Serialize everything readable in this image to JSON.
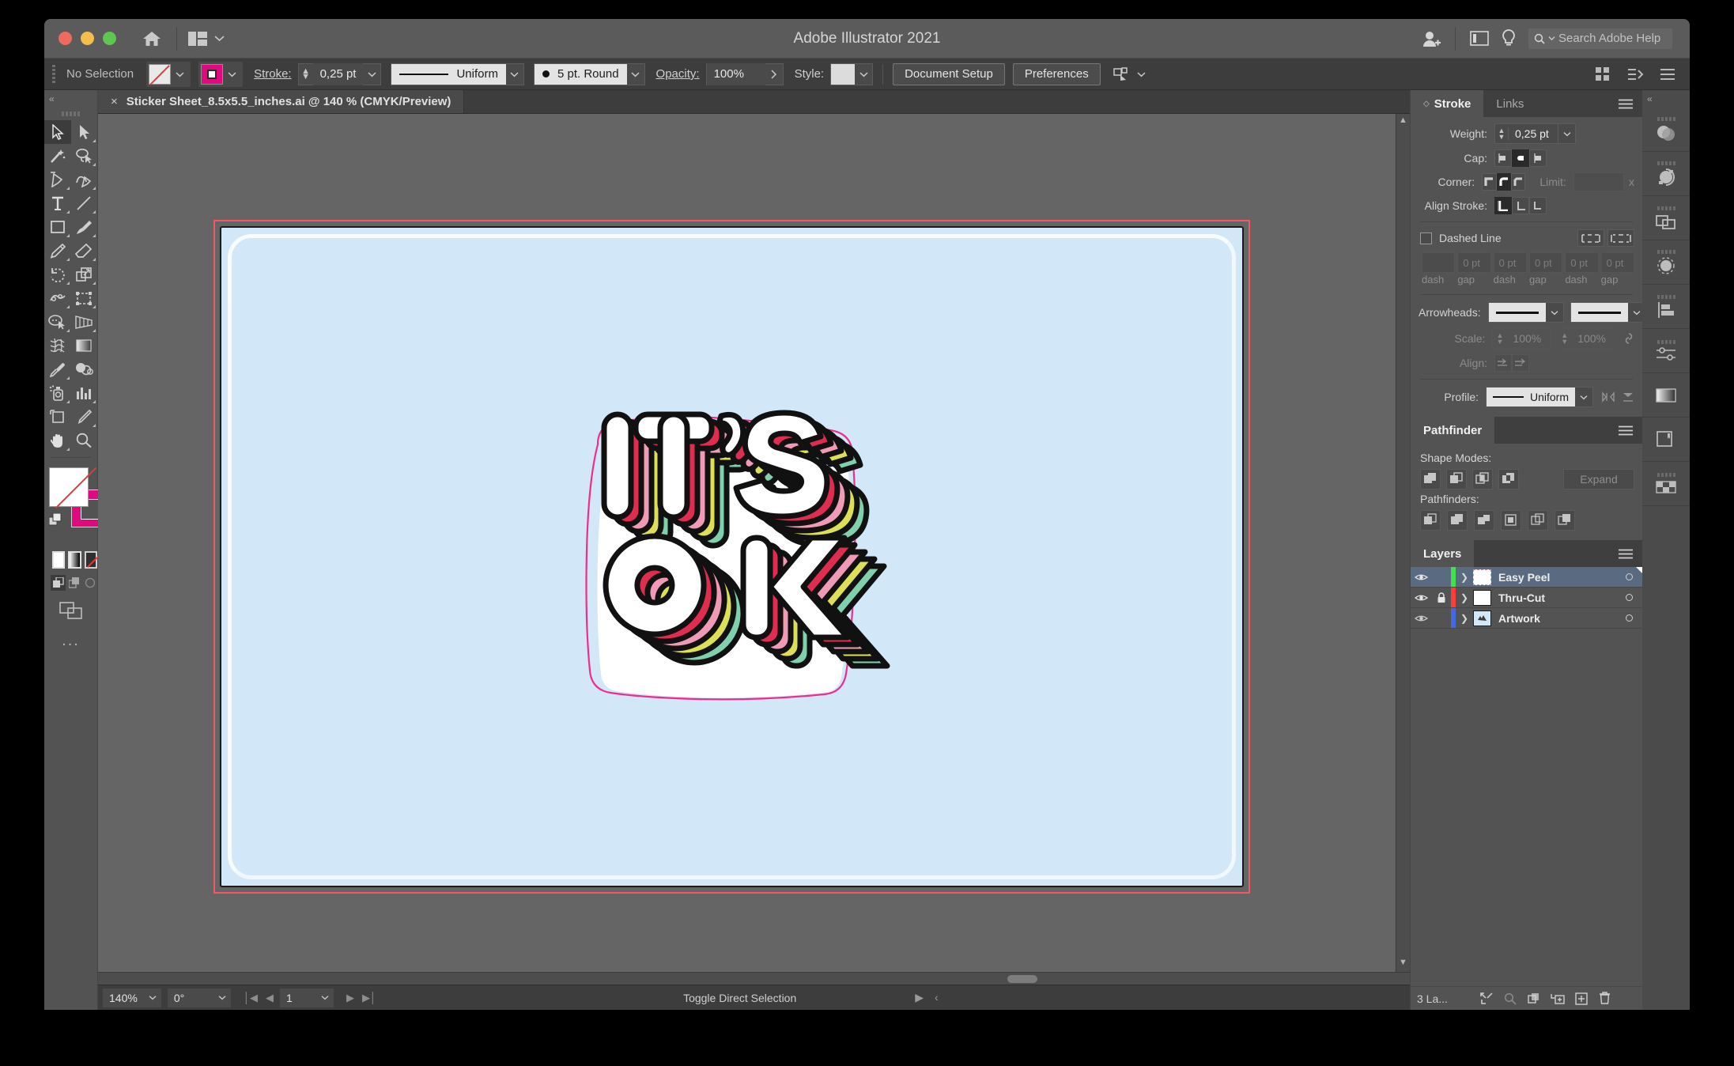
{
  "app": {
    "title": "Adobe Illustrator 2021"
  },
  "titlebar": {
    "home_icon": "home-icon",
    "arrange_icon": "arrange-documents-icon",
    "caret_icon": "chevron-down-icon",
    "account_icon": "account-add-icon",
    "panel_icon": "workspace-panel-icon",
    "tips_icon": "lightbulb-icon",
    "search_icon": "search-icon",
    "search_placeholder": "Search Adobe Help"
  },
  "controlbar": {
    "selection_status": "No Selection",
    "fill_swatch": "none",
    "stroke_swatch_color": "#e0097f",
    "stroke_label": "Stroke:",
    "stroke_weight": "0,25 pt",
    "variable_width_profile": "Uniform",
    "brush_definition": "5 pt. Round",
    "opacity_label": "Opacity:",
    "opacity_value": "100%",
    "style_label": "Style:",
    "document_setup_label": "Document Setup",
    "preferences_label": "Preferences",
    "align_icon": "align-objects-icon",
    "arrange_icon": "arrange-icon",
    "view_icon": "view-options-icon",
    "list_icon": "list-icon"
  },
  "tools": [
    {
      "name": "selection-tool",
      "icon": "arrow-solid",
      "selected": true
    },
    {
      "name": "direct-selection-tool",
      "icon": "arrow-hollow",
      "selected": false
    },
    {
      "name": "magic-wand-tool",
      "icon": "wand",
      "selected": false
    },
    {
      "name": "lasso-tool",
      "icon": "lasso",
      "selected": false
    },
    {
      "name": "pen-tool",
      "icon": "pen",
      "selected": false
    },
    {
      "name": "curvature-tool",
      "icon": "curvature",
      "selected": false
    },
    {
      "name": "type-tool",
      "icon": "type-t",
      "selected": false
    },
    {
      "name": "line-segment-tool",
      "icon": "line",
      "selected": false
    },
    {
      "name": "rectangle-tool",
      "icon": "rectangle",
      "selected": false
    },
    {
      "name": "paintbrush-tool",
      "icon": "brush",
      "selected": false
    },
    {
      "name": "pencil-tool",
      "icon": "pencil",
      "selected": false
    },
    {
      "name": "eraser-tool",
      "icon": "eraser",
      "selected": false
    },
    {
      "name": "rotate-tool",
      "icon": "rotate",
      "selected": false
    },
    {
      "name": "scale-tool",
      "icon": "scale",
      "selected": false
    },
    {
      "name": "width-tool",
      "icon": "width",
      "selected": false
    },
    {
      "name": "free-transform-tool",
      "icon": "free-transform",
      "selected": false
    },
    {
      "name": "shape-builder-tool",
      "icon": "shape-builder",
      "selected": false
    },
    {
      "name": "perspective-grid-tool",
      "icon": "perspective-grid",
      "selected": false
    },
    {
      "name": "mesh-tool",
      "icon": "mesh",
      "selected": false
    },
    {
      "name": "gradient-tool",
      "icon": "gradient",
      "selected": false
    },
    {
      "name": "eyedropper-tool",
      "icon": "eyedropper",
      "selected": false
    },
    {
      "name": "blend-tool",
      "icon": "blend",
      "selected": false
    },
    {
      "name": "symbol-sprayer-tool",
      "icon": "symbol-sprayer",
      "selected": false
    },
    {
      "name": "column-graph-tool",
      "icon": "bar-graph",
      "selected": false
    },
    {
      "name": "artboard-tool",
      "icon": "artboard",
      "selected": false
    },
    {
      "name": "slice-tool",
      "icon": "slice-knife",
      "selected": false
    },
    {
      "name": "hand-tool",
      "icon": "hand",
      "selected": false
    },
    {
      "name": "zoom-tool",
      "icon": "magnifier",
      "selected": false
    }
  ],
  "toolbar_footer": {
    "fill_label": "fill-swatch-none",
    "stroke_color": "#e0097f",
    "swap_icon": "swap-fill-stroke-icon",
    "default_icon": "default-fill-stroke-icon",
    "color_mode_color": "color-swatch",
    "color_mode_gradient": "gradient-swatch",
    "color_mode_none": "none-swatch",
    "draw_normal": "draw-normal-icon",
    "draw_behind": "draw-behind-icon",
    "draw_inside": "draw-inside-icon",
    "screen_mode": "screen-mode-icon",
    "more_tools": "..."
  },
  "document": {
    "tab_close": "×",
    "tab_title": "Sticker Sheet_8.5x5.5_inches.ai @ 140 % (CMYK/Preview)",
    "artboard_bg": "#d2e7f7",
    "bleed_color": "#f05a62",
    "thru_cut_color": "#1b1b1b",
    "easy_peel_color": "#ee2d8f"
  },
  "artwork": {
    "line1": "IT'S",
    "line2": "OK",
    "face_color": "#ffffff",
    "outline_color": "#111111",
    "shadow_colors": [
      "#e02c4e",
      "#f09ab5",
      "#dde055",
      "#7fd1ae"
    ]
  },
  "statusbar": {
    "zoom_level": "140%",
    "rotation": "0°",
    "artboard_number": "1",
    "message": "Toggle Direct Selection",
    "first_icon": "first-artboard-icon",
    "prev_icon": "prev-artboard-icon",
    "next_icon": "next-artboard-icon",
    "last_icon": "last-artboard-icon"
  },
  "stroke_panel": {
    "tabs": [
      {
        "label": "Stroke",
        "active": true
      },
      {
        "label": "Links",
        "active": false
      }
    ],
    "menu_icon": "panel-menu-icon",
    "weight_label": "Weight:",
    "weight_value": "0,25 pt",
    "cap_label": "Cap:",
    "cap_options": [
      "butt-cap",
      "round-cap",
      "projecting-cap"
    ],
    "cap_selected": 1,
    "corner_label": "Corner:",
    "corner_options": [
      "miter-join",
      "round-join",
      "bevel-join"
    ],
    "corner_selected": 1,
    "limit_label": "Limit:",
    "limit_value": "",
    "limit_unit": "x",
    "align_stroke_label": "Align Stroke:",
    "align_options": [
      "align-center",
      "align-inside",
      "align-outside"
    ],
    "align_selected": 0,
    "dashed_line_label": "Dashed Line",
    "dashed_checked": false,
    "dash_preserve_icon": "dash-preserve-exact-icon",
    "dash_adjust_icon": "dash-adjust-corners-icon",
    "dash_fields": [
      {
        "value": "",
        "label": "dash"
      },
      {
        "value": "0 pt",
        "label": "gap"
      },
      {
        "value": "0 pt",
        "label": "dash"
      },
      {
        "value": "0 pt",
        "label": "gap"
      },
      {
        "value": "0 pt",
        "label": "dash"
      },
      {
        "value": "0 pt",
        "label": "gap"
      }
    ],
    "arrowheads_label": "Arrowheads:",
    "swap_arrows_icon": "swap-arrowheads-icon",
    "scale_label": "Scale:",
    "scale_start": "100%",
    "scale_end": "100%",
    "link_icon": "link-scale-icon",
    "align_row_label": "Align:",
    "align_row_options": [
      "extend-arrow-tip",
      "place-arrow-tip"
    ],
    "profile_label": "Profile:",
    "profile_value": "Uniform",
    "flip_across_icon": "flip-across-icon",
    "flip_along_icon": "flip-along-icon"
  },
  "pathfinder_panel": {
    "title": "Pathfinder",
    "menu_icon": "panel-menu-icon",
    "shape_modes_label": "Shape Modes:",
    "shape_modes": [
      "unite",
      "minus-front",
      "intersect",
      "exclude"
    ],
    "expand_label": "Expand",
    "pathfinders_label": "Pathfinders:",
    "pathfinders": [
      "divide",
      "trim",
      "merge",
      "crop",
      "outline",
      "minus-back"
    ]
  },
  "layers_panel": {
    "title": "Layers",
    "menu_icon": "panel-menu-icon",
    "rows": [
      {
        "name": "Easy Peel",
        "color": "#3fe24a",
        "visible": true,
        "locked": false,
        "selected": true,
        "thumb": "dashed-rect"
      },
      {
        "name": "Thru-Cut",
        "color": "#ff3b3b",
        "visible": true,
        "locked": true,
        "selected": false,
        "thumb": "plain-rect"
      },
      {
        "name": "Artwork",
        "color": "#4169e1",
        "visible": true,
        "locked": false,
        "selected": false,
        "thumb": "artwork"
      }
    ],
    "footer_count": "3 La...",
    "footer_icons": [
      "locate-object-icon",
      "make-clipping-mask-icon",
      "create-new-sublayer-icon",
      "create-new-layer-icon",
      "delete-selection-icon"
    ],
    "footer_search_icon": "search-layers-icon"
  },
  "rail": {
    "left_items": [
      "transparency-icon",
      "recolor-artwork-icon"
    ],
    "right_items": [
      "layers-stack-icon",
      "selection-dashed-icon",
      "align-icon",
      "attributes-sliders-icon",
      "gradient-icon",
      "artboards-icon",
      "swatches-grid-icon"
    ],
    "collapse_icon": "collapse-panels-icon"
  }
}
